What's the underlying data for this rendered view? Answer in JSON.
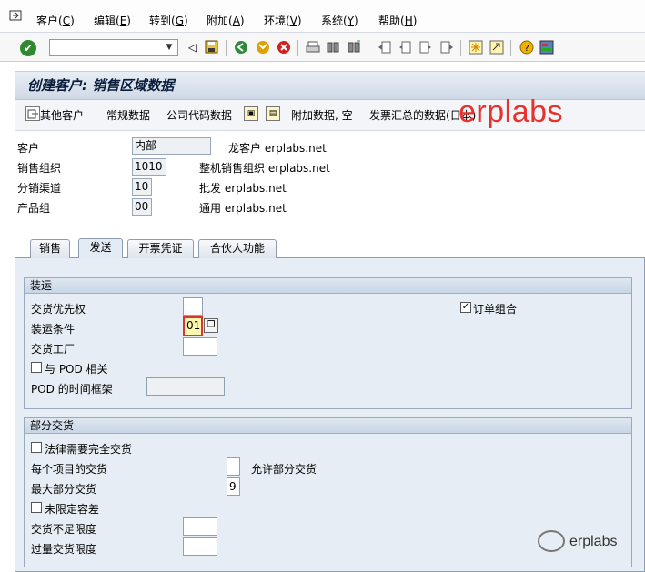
{
  "menubar": {
    "items": [
      {
        "label": "客户(",
        "key": "C",
        "end": ")"
      },
      {
        "label": "编辑(",
        "key": "E",
        "end": ")"
      },
      {
        "label": "转到(",
        "key": "G",
        "end": ")"
      },
      {
        "label": "附加(",
        "key": "A",
        "end": ")"
      },
      {
        "label": "环境(",
        "key": "V",
        "end": ")"
      },
      {
        "label": "系统(",
        "key": "Y",
        "end": ")"
      },
      {
        "label": "帮助(",
        "key": "H",
        "end": ")"
      }
    ]
  },
  "toolbar": {
    "command_value": "",
    "icons": [
      "enter-icon",
      "save-icon",
      "back-icon",
      "exit-icon",
      "cancel-icon",
      "print-icon",
      "find-icon",
      "find-next-icon",
      "first-page-icon",
      "prev-page-icon",
      "next-page-icon",
      "last-page-icon",
      "new-session-icon",
      "shortcut-icon",
      "help-icon",
      "layout-icon"
    ]
  },
  "title": "创建客户: 销售区域数据",
  "appbar": {
    "other_customer": "其他客户",
    "general_data": "常规数据",
    "company_code_data": "公司代码数据",
    "additional_data": "附加数据, 空",
    "invoice_summary": "发票汇总的数据(日本)"
  },
  "watermark": "erplabs",
  "header": {
    "customer": {
      "label": "客户",
      "value": "内部",
      "desc": "龙客户 erplabs.net"
    },
    "sales_org": {
      "label": "销售组织",
      "value": "1010",
      "desc": "整机销售组织 erplabs.net"
    },
    "distribution_channel": {
      "label": "分销渠道",
      "value": "10",
      "desc": "批发 erplabs.net"
    },
    "division": {
      "label": "产品组",
      "value": "00",
      "desc": "通用 erplabs.net"
    }
  },
  "tabs": [
    {
      "label": "销售",
      "active": false
    },
    {
      "label": "发送",
      "active": true
    },
    {
      "label": "开票凭证",
      "active": false
    },
    {
      "label": "合伙人功能",
      "active": false
    }
  ],
  "shipping": {
    "title": "装运",
    "delivery_priority": {
      "label": "交货优先权",
      "value": ""
    },
    "shipping_conditions": {
      "label": "装运条件",
      "value": "01"
    },
    "delivering_plant": {
      "label": "交货工厂",
      "value": ""
    },
    "pod_relevant": {
      "label": "与 POD 相关",
      "checked": false
    },
    "pod_timeframe": {
      "label": "POD 的时间框架",
      "value": ""
    },
    "order_combination": {
      "label": "订单组合",
      "checked": true
    }
  },
  "partial_delivery": {
    "title": "部分交货",
    "complete_delivery": {
      "label": "法律需要完全交货",
      "checked": false
    },
    "per_item": {
      "label": "每个项目的交货",
      "value": "",
      "desc": "允许部分交货"
    },
    "max_partial": {
      "label": "最大部分交货",
      "value": "9"
    },
    "unlimited_tolerance": {
      "label": "未限定容差",
      "checked": false
    },
    "underdelivery": {
      "label": "交货不足限度",
      "value": ""
    },
    "overdelivery": {
      "label": "过量交货限度",
      "value": ""
    }
  },
  "watermark2": "erplabs"
}
